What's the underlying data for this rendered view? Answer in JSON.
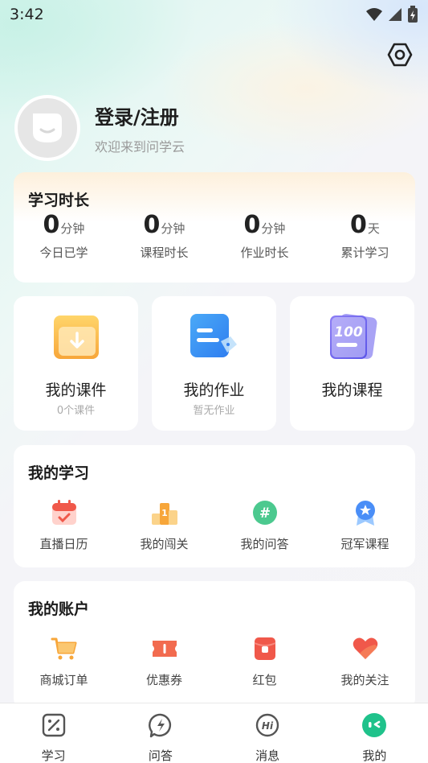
{
  "status_bar": {
    "time": "3:42"
  },
  "profile": {
    "login_label": "登录/注册",
    "welcome_text": "欢迎来到问学云"
  },
  "study_time": {
    "title": "学习时长",
    "stats": [
      {
        "value": "0",
        "unit": "分钟",
        "label": "今日已学"
      },
      {
        "value": "0",
        "unit": "分钟",
        "label": "课程时长"
      },
      {
        "value": "0",
        "unit": "分钟",
        "label": "作业时长"
      },
      {
        "value": "0",
        "unit": "天",
        "label": "累计学习"
      }
    ]
  },
  "tiles": [
    {
      "label": "我的课件",
      "sub": "0个课件",
      "icon": "courseware-icon"
    },
    {
      "label": "我的作业",
      "sub": "暂无作业",
      "icon": "homework-icon"
    },
    {
      "label": "我的课程",
      "sub": "",
      "icon": "course-100-icon"
    }
  ],
  "my_learning": {
    "title": "我的学习",
    "items": [
      {
        "label": "直播日历",
        "icon": "calendar-icon"
      },
      {
        "label": "我的闯关",
        "icon": "podium-icon"
      },
      {
        "label": "我的问答",
        "icon": "hashtag-icon"
      },
      {
        "label": "冠军课程",
        "icon": "medal-icon"
      }
    ]
  },
  "my_account": {
    "title": "我的账户",
    "items": [
      {
        "label": "商城订单",
        "icon": "cart-icon"
      },
      {
        "label": "优惠券",
        "icon": "coupon-icon"
      },
      {
        "label": "红包",
        "icon": "red-packet-icon"
      },
      {
        "label": "我的关注",
        "icon": "heart-icon"
      }
    ]
  },
  "tabbar": {
    "tabs": [
      {
        "label": "学习",
        "icon": "study-icon",
        "active": false
      },
      {
        "label": "问答",
        "icon": "qa-icon",
        "active": false
      },
      {
        "label": "消息",
        "icon": "message-icon",
        "active": false
      },
      {
        "label": "我的",
        "icon": "profile-icon",
        "active": true
      }
    ]
  },
  "colors": {
    "accent": "#1fc28b",
    "red": "#f0584a",
    "orange": "#f7a63a",
    "blue": "#4a8ef7"
  }
}
